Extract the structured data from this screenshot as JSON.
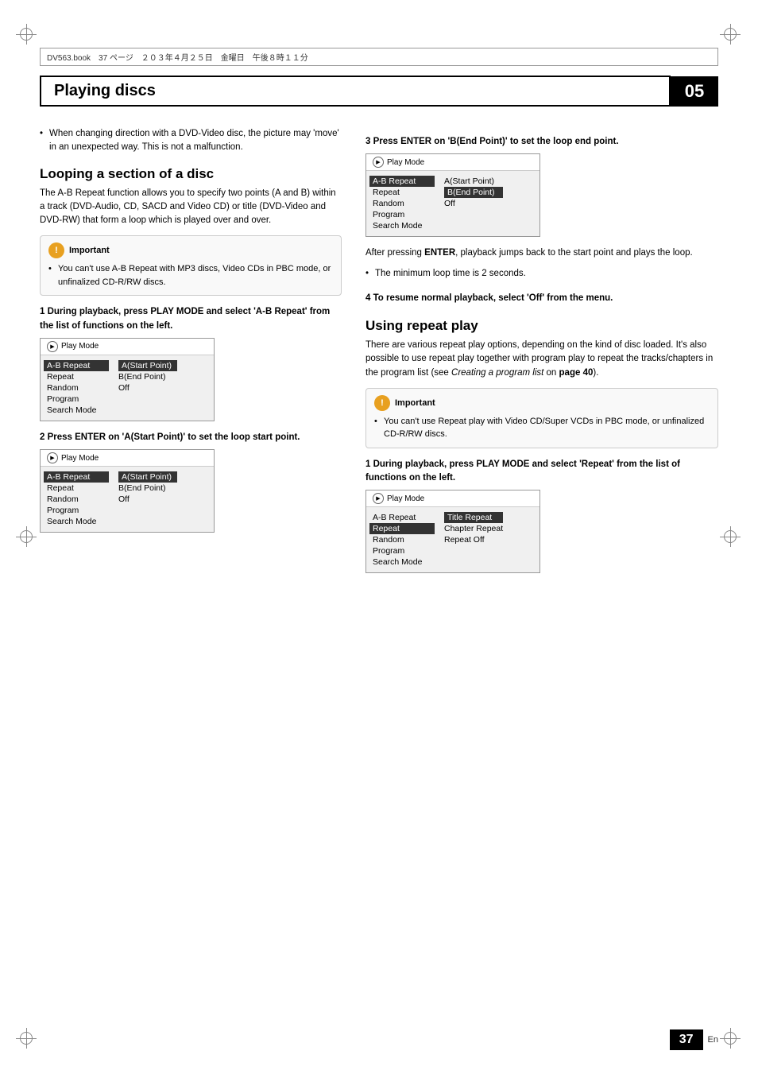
{
  "top_bar": {
    "text": "DV563.book　37 ページ　２０３年４月２５日　金曜日　午後８時１１分"
  },
  "chapter_header": {
    "title": "Playing discs",
    "number": "05"
  },
  "left_col": {
    "bullet1": "When changing direction with a DVD-Video disc, the picture may 'move' in an unexpected way. This is not a malfunction.",
    "section1_title": "Looping a section of a disc",
    "section1_desc": "The A-B Repeat function allows you to specify two points (A and B) within a track (DVD-Audio, CD, SACD and Video CD) or title (DVD-Video and DVD-RW) that form a loop which is played over and over.",
    "important1_title": "Important",
    "important1_text": "You can't use A-B Repeat with MP3 discs, Video CDs in PBC mode, or unfinalized CD-R/RW discs.",
    "step1_heading": "1   During playback, press PLAY MODE and select 'A-B Repeat' from the list of functions on the left.",
    "play_mode1": {
      "title": "Play Mode",
      "menu_left": [
        "A-B Repeat",
        "Repeat",
        "Random",
        "Program",
        "Search Mode"
      ],
      "menu_right": [
        "A(Start Point)",
        "B(End Point)",
        "Off"
      ],
      "selected_left": "A-B Repeat",
      "highlighted_right": "A(Start Point)"
    },
    "step2_heading": "2   Press ENTER on 'A(Start Point)' to set the loop start point.",
    "play_mode2": {
      "title": "Play Mode",
      "menu_left": [
        "A-B Repeat",
        "Repeat",
        "Random",
        "Program",
        "Search Mode"
      ],
      "menu_right": [
        "A(Start Point)",
        "B(End Point)",
        "Off"
      ],
      "selected_left": "A-B Repeat",
      "highlighted_right": "A(Start Point)"
    }
  },
  "right_col": {
    "step3_heading": "3   Press ENTER on 'B(End Point)' to set the loop end point.",
    "play_mode3": {
      "title": "Play Mode",
      "menu_left": [
        "A-B Repeat",
        "Repeat",
        "Random",
        "Program",
        "Search Mode"
      ],
      "menu_right": [
        "A(Start Point)",
        "B(End Point)",
        "Off"
      ],
      "selected_left": "A-B Repeat",
      "highlighted_right": "B(End Point)"
    },
    "after_enter_text1": "After pressing ",
    "after_enter_bold": "ENTER",
    "after_enter_text2": ", playback jumps back to the start point and plays the loop.",
    "bullet_min_loop": "The minimum loop time is 2 seconds.",
    "step4_heading": "4   To resume normal playback, select 'Off' from the menu.",
    "section2_title": "Using repeat play",
    "section2_desc": "There are various repeat play options, depending on the kind of disc loaded. It's also possible to use repeat play together with program play to repeat the tracks/chapters in the program list (see ",
    "section2_italic": "Creating a program list",
    "section2_desc2": " on ",
    "section2_bold": "page 40",
    "section2_desc3": ").",
    "important2_title": "Important",
    "important2_text": "You can't use Repeat play with Video CD/Super VCDs in PBC mode, or unfinalized CD-R/RW discs.",
    "step5_heading": "1   During playback, press PLAY MODE and select 'Repeat' from the list of functions on the left.",
    "play_mode4": {
      "title": "Play Mode",
      "menu_left": [
        "A-B Repeat",
        "Repeat",
        "Random",
        "Program",
        "Search Mode"
      ],
      "menu_right": [
        "Title Repeat",
        "Chapter Repeat",
        "Repeat Off"
      ],
      "selected_left": "Repeat",
      "highlighted_right": "Title Repeat"
    }
  },
  "footer": {
    "page_number": "37",
    "lang": "En"
  }
}
